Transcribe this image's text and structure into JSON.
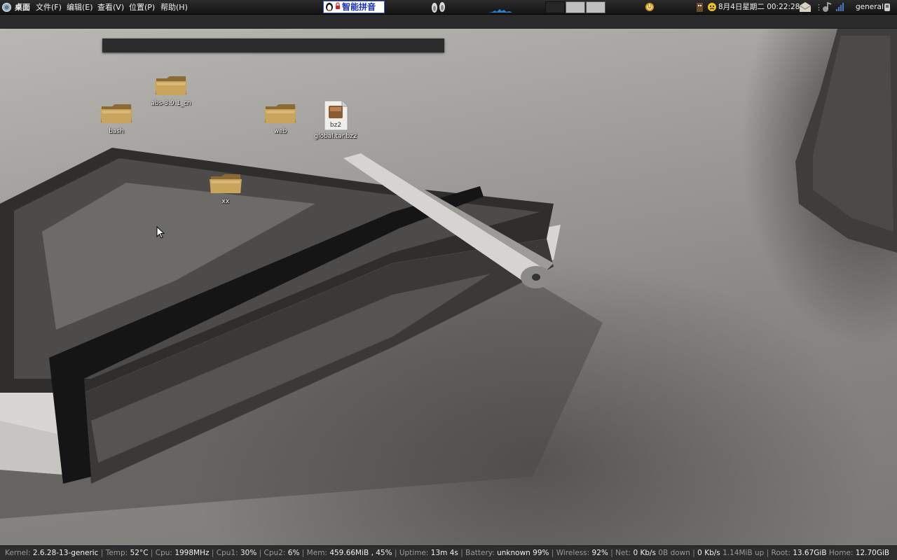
{
  "top_panel": {
    "menus": [
      {
        "label": "桌面",
        "bold": true
      },
      {
        "label": "文件(F)"
      },
      {
        "label": "编辑(E)"
      },
      {
        "label": "查看(V)"
      },
      {
        "label": "位置(P)"
      },
      {
        "label": "帮助(H)"
      }
    ],
    "ime_label": "智能拼音",
    "clock": "8月4日星期二 00:22:28",
    "user": "general"
  },
  "desktop_icons": [
    {
      "name": "abs-3.9.1_cn",
      "type": "folder"
    },
    {
      "name": "bash",
      "type": "folder"
    },
    {
      "name": "web",
      "type": "folder"
    },
    {
      "name": "global.tar.bz2",
      "type": "archive",
      "badge": "bz2"
    },
    {
      "name": "xx",
      "type": "folder"
    }
  ],
  "status_bar": {
    "items": [
      {
        "key": "Kernel:",
        "value": "2.6.28-13-generic"
      },
      {
        "key": "Temp:",
        "value": "52°C"
      },
      {
        "key": "Cpu:",
        "value": "1998MHz"
      },
      {
        "key": "Cpu1:",
        "value": "30%"
      },
      {
        "key": "Cpu2:",
        "value": "6%"
      },
      {
        "key": "Mem:",
        "value": "459.66MiB , 45%"
      },
      {
        "key": "Uptime:",
        "value": "13m 4s"
      },
      {
        "key": "Battery:",
        "value": "unknown 99%"
      },
      {
        "key": "Wireless:",
        "value": "92%"
      },
      {
        "key": "Net:",
        "value": "0 Kb/s",
        "extra": "0B down"
      },
      {
        "key": "",
        "value": "0 Kb/s",
        "extra": "1.14MiB up"
      },
      {
        "key": "Root:",
        "value": "13.67GiB"
      },
      {
        "key": "Home:",
        "value": "12.70GiB"
      }
    ]
  },
  "colors": {
    "panel_bg": "#1f1f1f",
    "folder_gold": "#c9a45c",
    "ime_blue": "#1530c8"
  }
}
